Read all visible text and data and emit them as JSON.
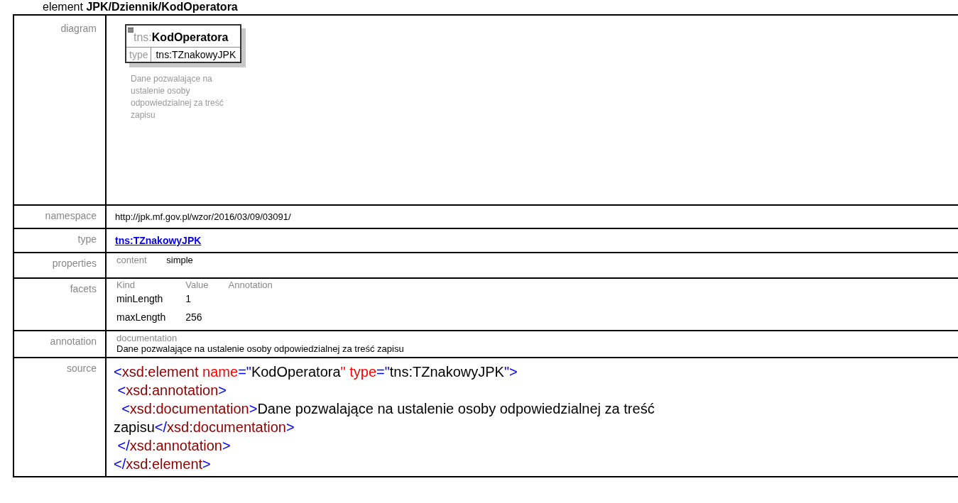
{
  "heading": {
    "prefix": "element",
    "path": "JPK/Dziennik/KodOperatora"
  },
  "diagram": {
    "label": "diagram",
    "prefix": "tns:",
    "name": "KodOperatora",
    "type_label": "type",
    "type_value": "tns:TZnakowyJPK",
    "note": "Dane pozwalające na ustalenie osoby odpowiedzialnej za treść zapisu"
  },
  "namespace": {
    "label": "namespace",
    "value": "http://jpk.mf.gov.pl/wzor/2016/03/09/03091/"
  },
  "type": {
    "label": "type",
    "link": "tns:TZnakowyJPK"
  },
  "properties": {
    "label": "properties",
    "name": "content",
    "value": "simple"
  },
  "facets": {
    "label": "facets",
    "columns": [
      "Kind",
      "Value",
      "Annotation"
    ],
    "rows": [
      [
        "minLength",
        "1"
      ],
      [
        "maxLength",
        "256"
      ]
    ]
  },
  "annotation": {
    "label": "annotation",
    "kind": "documentation",
    "text": "Dane pozwalające na ustalenie osoby odpowiedzialnej za treść zapisu"
  },
  "source": {
    "label": "source",
    "lines": [
      [
        {
          "kind": "punct",
          "text": "<"
        },
        {
          "kind": "tag",
          "text": "xsd:element"
        },
        {
          "kind": "attr",
          "text": " name"
        },
        {
          "kind": "punct",
          "text": "=\""
        },
        {
          "kind": "text",
          "text": "KodOperatora"
        },
        {
          "kind": "attr",
          "text": "\" type"
        },
        {
          "kind": "punct",
          "text": "=\""
        },
        {
          "kind": "text",
          "text": "tns:TZnakowyJPK"
        },
        {
          "kind": "punct",
          "text": "\">"
        }
      ],
      [
        {
          "kind": "punct",
          "text": " <"
        },
        {
          "kind": "tag",
          "text": "xsd:annotation"
        },
        {
          "kind": "punct",
          "text": ">"
        }
      ],
      [
        {
          "kind": "punct",
          "text": "  <"
        },
        {
          "kind": "tag",
          "text": "xsd:documentation"
        },
        {
          "kind": "punct",
          "text": ">"
        },
        {
          "kind": "text",
          "text": "Dane pozwalające na ustalenie osoby odpowiedzialnej za treść zapisu"
        },
        {
          "kind": "punct",
          "text": "</"
        },
        {
          "kind": "tag",
          "text": "xsd:documentation"
        },
        {
          "kind": "punct",
          "text": ">"
        }
      ],
      [
        {
          "kind": "punct",
          "text": " </"
        },
        {
          "kind": "tag",
          "text": "xsd:annotation"
        },
        {
          "kind": "punct",
          "text": ">"
        }
      ],
      [
        {
          "kind": "punct",
          "text": "</"
        },
        {
          "kind": "tag",
          "text": "xsd:element"
        },
        {
          "kind": "punct",
          "text": ">"
        }
      ]
    ]
  }
}
